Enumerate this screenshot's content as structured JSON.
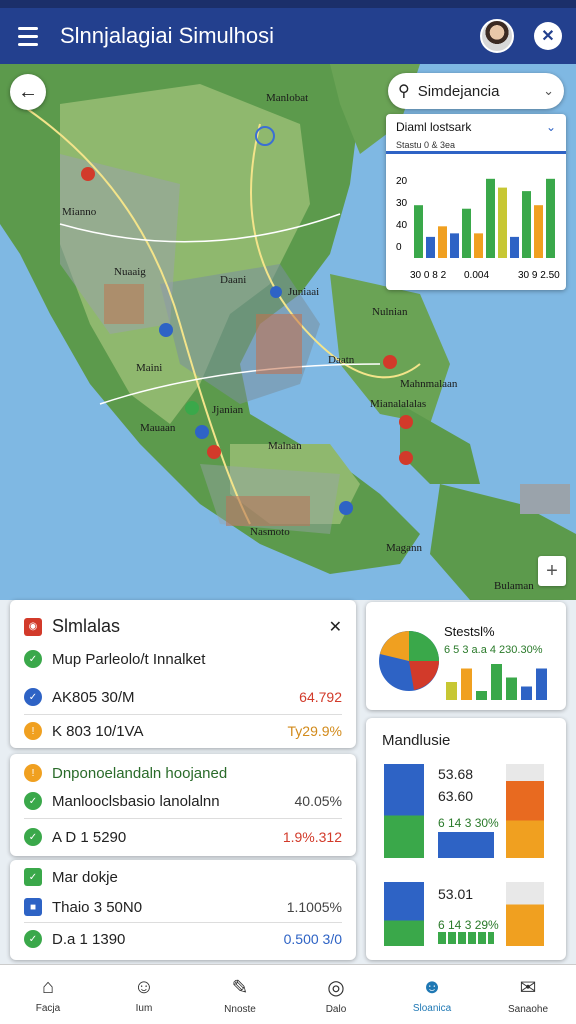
{
  "app": {
    "title": "Slnnjalagiai Simulhosi"
  },
  "map": {
    "labels": [
      "Manlobat",
      "Mianno",
      "Nuaaig",
      "Daani",
      "Juniaai",
      "Maini",
      "Nulnian",
      "Daatn",
      "Mahnmalaan",
      "Mianalalalas",
      "Mauaan",
      "Jjanian",
      "Malnan",
      "Nasmoto",
      "Magann",
      "Bulaman"
    ]
  },
  "search": {
    "text": "Simdejancia"
  },
  "mini_chart": {
    "title": "Diaml lostsark",
    "subtitle": "Stastu 0 & 3ea",
    "yticks": [
      "20",
      "30",
      "40",
      "0"
    ],
    "xticks": [
      "30 0 8 2",
      "0.004",
      "30 9 2.50"
    ]
  },
  "chart_data": {
    "type": "bar",
    "title": "Diaml lostsark",
    "categories": [
      "30 0 8 2",
      "0.004",
      "30 9 2.50"
    ],
    "series": [
      {
        "values": [
          30,
          12,
          18,
          14,
          28,
          14,
          45,
          40,
          12,
          38,
          30,
          45
        ]
      }
    ],
    "ylim": [
      0,
      50
    ]
  },
  "panel_left_top": {
    "title": "Slmlalas",
    "rows": [
      {
        "label": "Mup Parleolo/t Innalket",
        "value": ""
      },
      {
        "label": "AK805 30/M",
        "value": "64.792"
      },
      {
        "label": "K 803 10/1VA",
        "value": "Ty29.9%"
      }
    ]
  },
  "panel_left_mid": {
    "rows": [
      {
        "label": "Dnponoelandaln hoojaned",
        "value": ""
      },
      {
        "label": "Manlooclsbasio lanolalnn",
        "value": "40.05%"
      },
      {
        "label": "A D 1 5290",
        "value": "1.9%.312"
      }
    ]
  },
  "panel_left_bot": {
    "rows": [
      {
        "label": "Mar dokje",
        "value": ""
      },
      {
        "label": "Thaio 3 50N0",
        "value": "1.1005%"
      },
      {
        "label": "D.a 1 1390",
        "value": "0.500 3/0"
      }
    ]
  },
  "panel_right_top": {
    "title": "Stestsl%",
    "sub": "6 5 3 a.a 4 230.30%",
    "pie": [
      40,
      25,
      20,
      15
    ],
    "bars": [
      20,
      35,
      10,
      40,
      25,
      15,
      35
    ]
  },
  "panel_right_bot": {
    "title": "Mandlusie",
    "block1": {
      "v1": "53.68",
      "v2": "63.60",
      "pct": "6 14 3 30%"
    },
    "block2": {
      "v1": "53.01",
      "pct": "6 14 3 29%"
    }
  },
  "nav": [
    {
      "label": "Facja",
      "icon": "home-icon"
    },
    {
      "label": "Ium",
      "icon": "person-icon"
    },
    {
      "label": "Nnoste",
      "icon": "tag-icon"
    },
    {
      "label": "Dalo",
      "icon": "location-icon"
    },
    {
      "label": "Sloanica",
      "icon": "smile-icon"
    },
    {
      "label": "Sanaohe",
      "icon": "chat-icon"
    }
  ],
  "colors": {
    "primary": "#23408e",
    "accent_blue": "#2e63c5",
    "green": "#3aa84a",
    "orange": "#f0a020",
    "red": "#d23a2a"
  }
}
